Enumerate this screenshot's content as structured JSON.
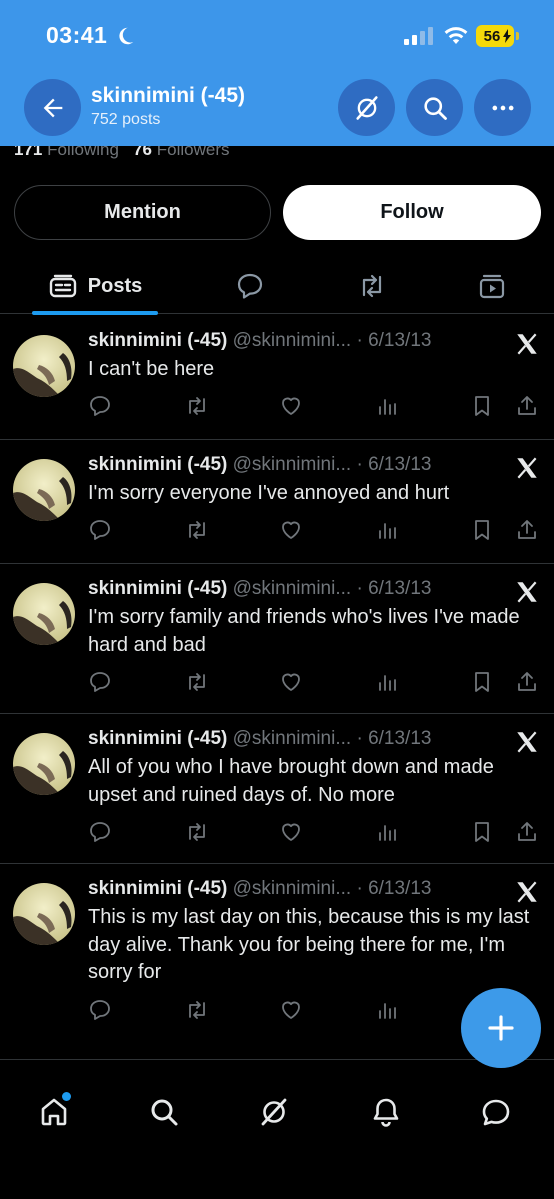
{
  "status_bar": {
    "time": "03:41",
    "battery": "56"
  },
  "header": {
    "title": "skinnimini (-45)",
    "post_count": "752 posts"
  },
  "profile_peek": {
    "following_count": "171",
    "following_label": "Following",
    "followers_count": "76",
    "followers_label": "Followers"
  },
  "actions": {
    "mention_label": "Mention",
    "follow_label": "Follow"
  },
  "tabs": {
    "posts_label": "Posts"
  },
  "posts": [
    {
      "name": "skinnimini (-45)",
      "handle": "@skinnimini...",
      "date": "6/13/13",
      "text": "I can't be here"
    },
    {
      "name": "skinnimini (-45)",
      "handle": "@skinnimini...",
      "date": "6/13/13",
      "text": "I'm sorry everyone I've annoyed and hurt"
    },
    {
      "name": "skinnimini (-45)",
      "handle": "@skinnimini...",
      "date": "6/13/13",
      "text": "I'm sorry family and friends who's lives I've made hard and bad"
    },
    {
      "name": "skinnimini (-45)",
      "handle": "@skinnimini...",
      "date": "6/13/13",
      "text": "All of you who I have brought down and made upset and ruined days of. No more"
    },
    {
      "name": "skinnimini (-45)",
      "handle": "@skinnimini...",
      "date": "6/13/13",
      "text": "This is my last day on this, because this is my last day alive. Thank you for being there for me, I'm sorry for"
    }
  ],
  "colors": {
    "header_bg": "#3d96ea",
    "accent": "#1d9bf0",
    "background": "#000000",
    "muted": "#71767b"
  },
  "icons": [
    "moon-icon",
    "signal-icon",
    "wifi-icon",
    "back-arrow-icon",
    "grok-icon",
    "search-icon",
    "more-icon",
    "posts-tab-icon",
    "reply-icon",
    "repost-icon",
    "media-icon",
    "x-logo-icon",
    "like-icon",
    "views-icon",
    "bookmark-icon",
    "share-icon",
    "compose-plus-icon",
    "home-icon",
    "bell-icon",
    "messages-icon"
  ]
}
